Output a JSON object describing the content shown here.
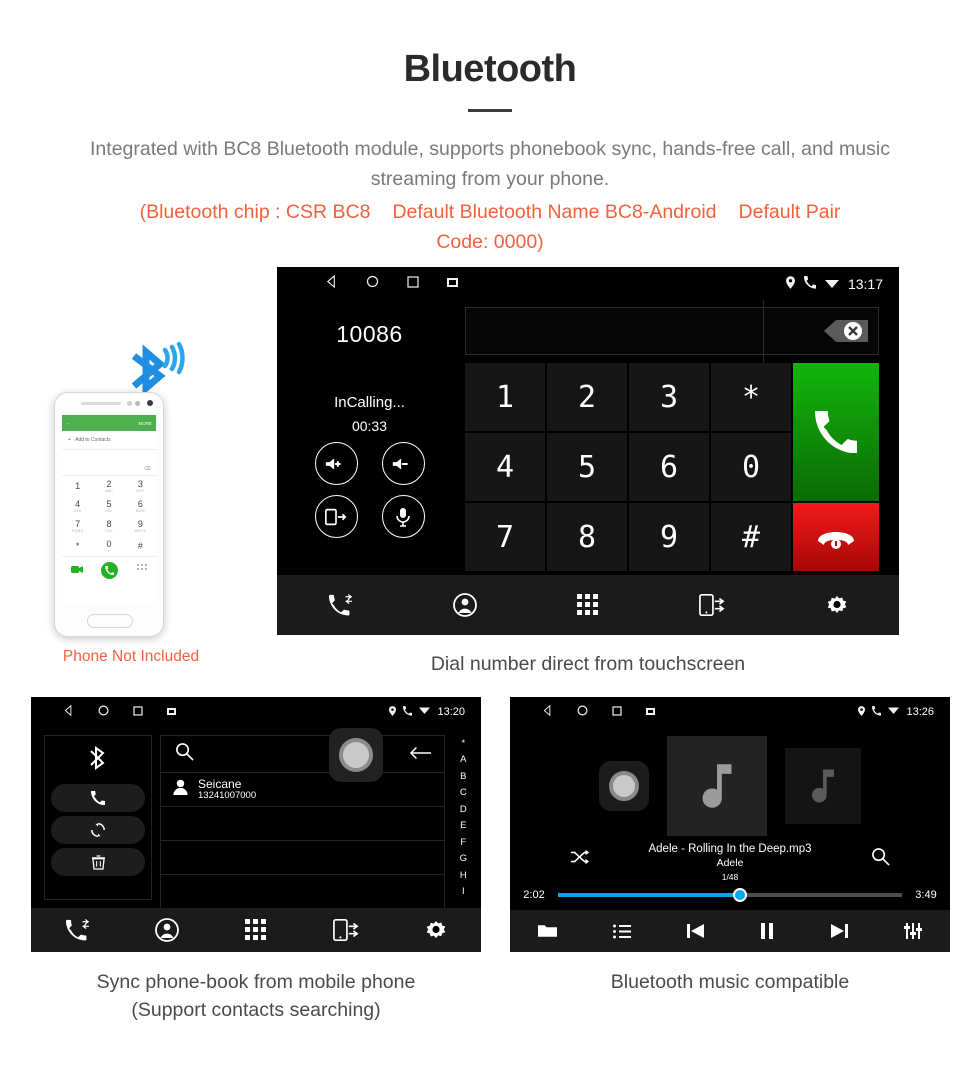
{
  "header": {
    "title": "Bluetooth",
    "intro": "Integrated with BC8 Bluetooth module, supports phonebook sync, hands-free call, and music streaming from your phone.",
    "spec_line1_a": "(Bluetooth chip : CSR BC8",
    "spec_line1_b": "Default Bluetooth Name BC8-Android",
    "spec_line1_c": "Default Pair",
    "spec_line2": "Code: 0000)",
    "accent_color": "#f4603c",
    "body_color": "#7a7a7a"
  },
  "dialer": {
    "status": {
      "time": "13:17",
      "icons": [
        "back-icon",
        "home-icon",
        "recents-icon",
        "screenshot-icon",
        "location-icon",
        "call-icon",
        "wifi-icon"
      ]
    },
    "number": "10086",
    "state": "InCalling...",
    "timer": "00:33",
    "controls": [
      "volume-up-icon",
      "volume-down-icon",
      "transfer-audio-icon",
      "mute-mic-icon"
    ],
    "backspace_icon": "backspace-icon",
    "keys": [
      "1",
      "2",
      "3",
      "*",
      "4",
      "5",
      "6",
      "0",
      "7",
      "8",
      "9",
      "#"
    ],
    "call_button": "call-answer-icon",
    "end_button": "call-end-icon",
    "call_color": "#13b50a",
    "end_color": "#f21b1b",
    "nav": [
      "call-log-icon",
      "contacts-icon",
      "keypad-icon",
      "sync-phone-icon",
      "settings-icon"
    ],
    "caption": "Dial number direct from touchscreen"
  },
  "phone_mock": {
    "appbar_more": "MORE",
    "add_to_contacts": "Add to Contacts",
    "backspace": "⌫",
    "keys": [
      {
        "d": "1",
        "s": ""
      },
      {
        "d": "2",
        "s": "ABC"
      },
      {
        "d": "3",
        "s": "DEF"
      },
      {
        "d": "4",
        "s": "GHI"
      },
      {
        "d": "5",
        "s": "JKL"
      },
      {
        "d": "6",
        "s": "MNO"
      },
      {
        "d": "7",
        "s": "PQRS"
      },
      {
        "d": "8",
        "s": "TUV"
      },
      {
        "d": "9",
        "s": "WXYZ"
      },
      {
        "d": "*",
        "s": ""
      },
      {
        "d": "0",
        "s": "+"
      },
      {
        "d": "#",
        "s": ""
      }
    ],
    "not_included": "Phone Not Included",
    "bluetooth_logo_color": "#1e8fe0"
  },
  "phonebook": {
    "status": {
      "time": "13:20"
    },
    "side_buttons": [
      "bluetooth-icon",
      "call-icon",
      "sync-icon",
      "delete-icon"
    ],
    "search_placeholder": "",
    "search_icon": "search-icon",
    "back_icon": "back-arrow-icon",
    "contacts": [
      {
        "name": "Seicane",
        "number": "13241007000"
      }
    ],
    "index_letters": [
      "*",
      "A",
      "B",
      "C",
      "D",
      "E",
      "F",
      "G",
      "H",
      "I"
    ],
    "nav": [
      "call-log-icon",
      "contacts-icon",
      "keypad-icon",
      "sync-phone-icon",
      "settings-icon"
    ],
    "caption_line1": "Sync phone-book from mobile phone",
    "caption_line2": "(Support contacts searching)"
  },
  "music": {
    "status": {
      "time": "13:26"
    },
    "track_title": "Adele - Rolling In the Deep.mp3",
    "artist": "Adele",
    "track_index": "1/48",
    "elapsed": "2:02",
    "duration": "3:49",
    "progress_percent": 53,
    "progress_color": "#0aa6e8",
    "shuffle_icon": "shuffle-icon",
    "search_icon": "search-icon",
    "controls": [
      "folder-icon",
      "playlist-icon",
      "previous-icon",
      "pause-icon",
      "next-icon",
      "equalizer-icon"
    ],
    "caption": "Bluetooth music compatible"
  }
}
